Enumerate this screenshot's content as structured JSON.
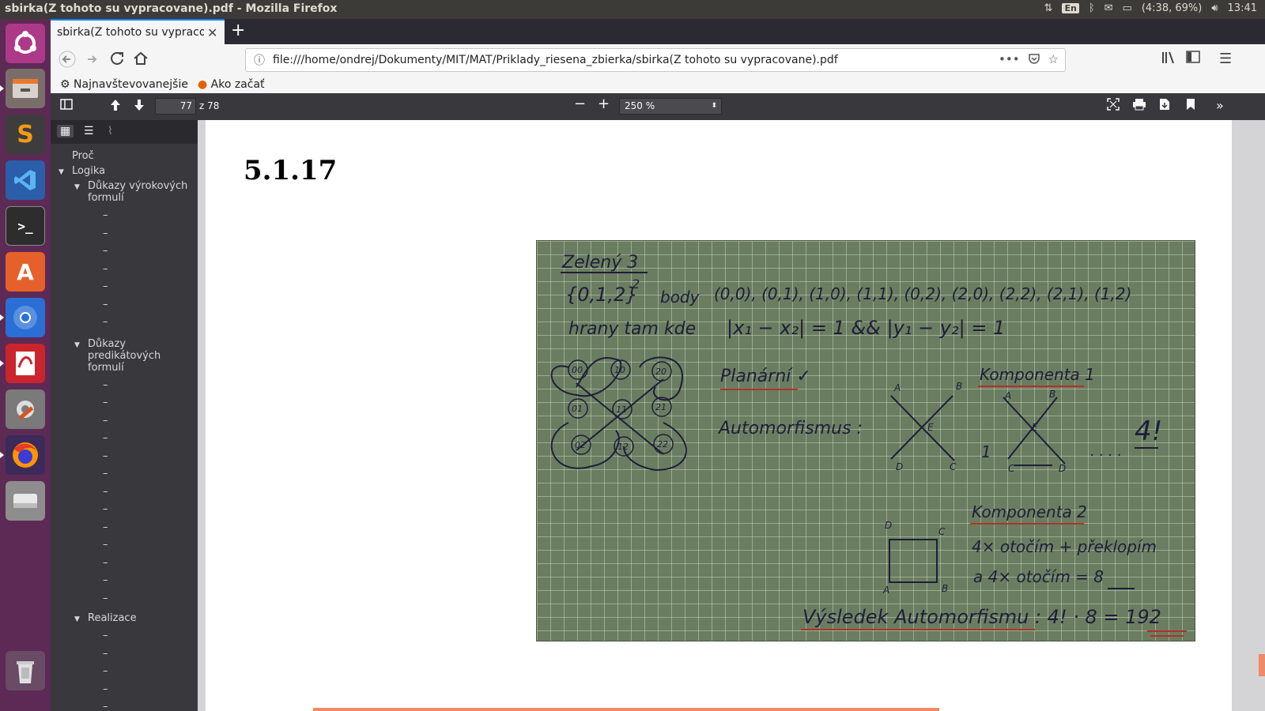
{
  "system": {
    "window_title": "sbirka(Z tohoto su vypracovane).pdf - Mozilla Firefox",
    "keyboard_layout": "En",
    "battery": "(4:38, 69%)",
    "clock": "13:41"
  },
  "browser": {
    "tab_title": "sbirka(Z tohoto su vypracovane).pdf",
    "url": "file:///home/ondrej/Dokumenty/MIT/MAT/Priklady_riesena_zbierka/sbirka(Z tohoto su vypracovane).pdf",
    "bookmarks": [
      "Najnavštevovanejšie",
      "Ako začať"
    ]
  },
  "pdf_toolbar": {
    "page_number": "77",
    "page_count": "z 78",
    "zoom": "250 %"
  },
  "outline": {
    "proc": "Proč",
    "logika": "Logika",
    "dukazy_vyrokovych": "Důkazy výrokových formulí",
    "dukazy_predikatovych": "Důkazy predikátových formulí",
    "realizace": "Realizace",
    "dash": "–"
  },
  "document": {
    "section_number": "5.1.17"
  },
  "photo_notes": {
    "heading": "Zelený 3",
    "set": "{0,1,2}",
    "set_exp": "2",
    "vertices_word": "body",
    "vertices": "(0,0), (0,1), (1,0), (1,1), (0,2), (2,0), (2,2), (2,1), (1,2)",
    "edges_word": "hrany tam kde",
    "edges_cond": "|x₁ − x₂| = 1 && |y₁ − y₂| = 1",
    "planar": "Planární ✓",
    "automorphisms": "Automorfismus :",
    "component1": "Komponenta 1",
    "component2": "Komponenta 2",
    "four_fact": "4!",
    "dots": ". . . .",
    "one": "1",
    "rotate_line1": "4× otočím + překlopím",
    "rotate_line2": "a 4× otočím = 8",
    "result": "Výsledek Automorfismu :  4! · 8 = 192",
    "labels": {
      "a": "A",
      "b": "B",
      "c": "C",
      "d": "D",
      "e": "E"
    },
    "graph_nodes": [
      "00",
      "10",
      "20",
      "01",
      "11",
      "21",
      "02",
      "12",
      "22"
    ]
  }
}
